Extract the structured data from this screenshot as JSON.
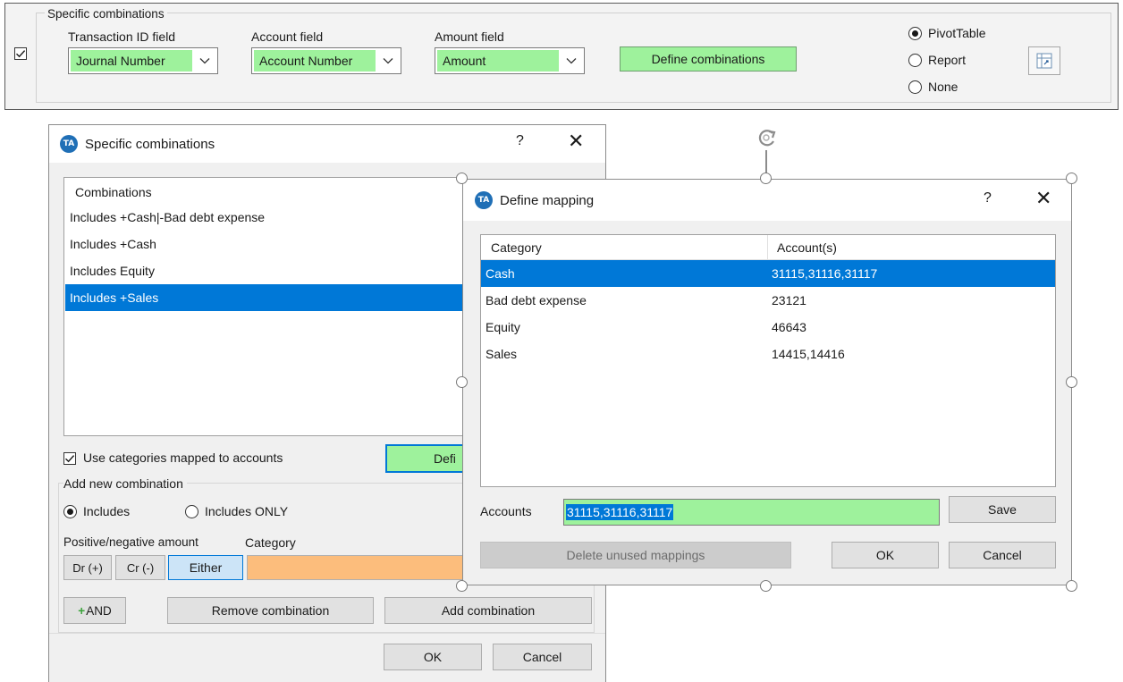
{
  "top_panel": {
    "group_title": "Specific combinations",
    "enabled_checked": true,
    "transaction_id": {
      "label": "Transaction ID field",
      "value": "Journal Number"
    },
    "account": {
      "label": "Account field",
      "value": "Account Number"
    },
    "amount": {
      "label": "Amount field",
      "value": "Amount"
    },
    "define_button": "Define combinations",
    "output_options": [
      "PivotTable",
      "Report",
      "None"
    ],
    "output_selected": "PivotTable",
    "icon": "output-settings-icon"
  },
  "combinations_dialog": {
    "title": "Specific combinations",
    "help": "?",
    "close": "✕",
    "list_header": "Combinations",
    "items": [
      "Includes +Cash|-Bad debt expense",
      "Includes +Cash",
      "Includes Equity",
      "Includes +Sales"
    ],
    "selected_index": 3,
    "use_categories_label": "Use categories mapped to accounts",
    "use_categories_checked": true,
    "define_button_partial": "Defi",
    "add_new_group": "Add new combination",
    "includes": "Includes",
    "includes_only": "Includes ONLY",
    "mode_selected": "Includes",
    "pos_neg_label": "Positive/negative amount",
    "category_label": "Category",
    "sign_buttons": [
      "Dr (+)",
      "Cr (-)",
      "Either"
    ],
    "sign_selected": "Either",
    "and_button": "AND",
    "remove_button": "Remove combination",
    "add_button": "Add combination",
    "ok": "OK",
    "cancel": "Cancel"
  },
  "mapping_dialog": {
    "title": "Define mapping",
    "help": "?",
    "close": "✕",
    "columns": [
      "Category",
      "Account(s)"
    ],
    "rows": [
      {
        "category": "Cash",
        "accounts": "31115,31116,31117"
      },
      {
        "category": "Bad debt expense",
        "accounts": "23121"
      },
      {
        "category": "Equity",
        "accounts": "46643"
      },
      {
        "category": "Sales",
        "accounts": "14415,14416"
      }
    ],
    "selected_row": 0,
    "accounts_label": "Accounts",
    "accounts_value": "31115,31116,31117",
    "save": "Save",
    "delete_unused": "Delete unused mappings",
    "ok": "OK",
    "cancel": "Cancel"
  },
  "colors": {
    "accent_green": "#9ef29c",
    "selection_blue": "#0078d7",
    "category_orange": "#fcbd7c",
    "either_blue": "#cce4f7"
  }
}
